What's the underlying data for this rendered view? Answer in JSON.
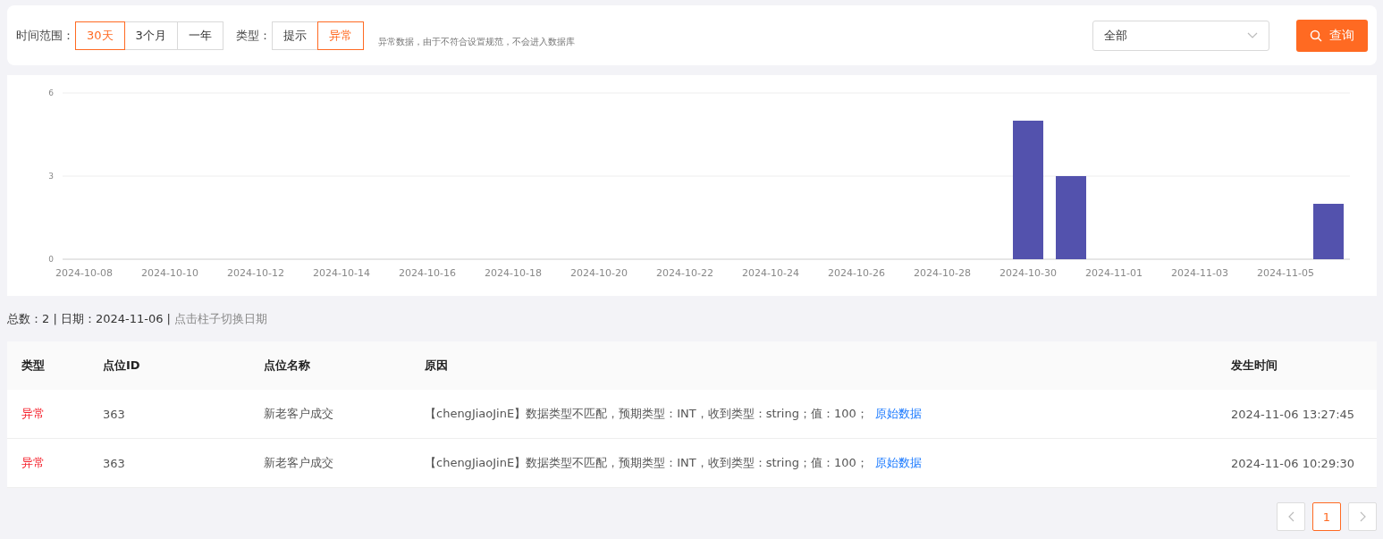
{
  "filters": {
    "range_label": "时间范围：",
    "ranges": [
      {
        "label": "30天",
        "selected": true
      },
      {
        "label": "3个月",
        "selected": false
      },
      {
        "label": "一年",
        "selected": false
      }
    ],
    "type_label": "类型：",
    "types": [
      {
        "label": "提示",
        "selected": false
      },
      {
        "label": "异常",
        "selected": true
      }
    ],
    "note": "异常数据，由于不符合设置规范，不会进入数据库",
    "select": {
      "value": "全部"
    },
    "query_button": "查询"
  },
  "chart": {
    "chart_data": {
      "type": "bar",
      "categories": [
        "2024-10-08",
        null,
        "2024-10-10",
        null,
        "2024-10-12",
        null,
        "2024-10-14",
        null,
        "2024-10-16",
        null,
        "2024-10-18",
        null,
        "2024-10-20",
        null,
        "2024-10-22",
        null,
        "2024-10-24",
        null,
        "2024-10-26",
        null,
        "2024-10-28",
        null,
        "2024-10-30",
        null,
        "2024-11-01",
        null,
        "2024-11-03",
        null,
        "2024-11-05",
        null
      ],
      "values": [
        0,
        0,
        0,
        0,
        0,
        0,
        0,
        0,
        0,
        0,
        0,
        0,
        0,
        0,
        0,
        0,
        0,
        0,
        0,
        0,
        0,
        0,
        5,
        3,
        0,
        0,
        0,
        0,
        0,
        2
      ],
      "ylim": [
        0,
        6
      ],
      "yticks": [
        0,
        3,
        6
      ]
    }
  },
  "summary": {
    "text": "总数：2 | 日期：2024-11-06 |",
    "hint": "点击柱子切换日期"
  },
  "table": {
    "columns": [
      "类型",
      "点位ID",
      "点位名称",
      "原因",
      "发生时间"
    ],
    "rows": [
      {
        "type": "异常",
        "kind": "error",
        "id": "363",
        "name": "新老客户成交",
        "reason": "【chengJiaoJinE】数据类型不匹配，预期类型：INT，收到类型：string；值：100；",
        "link": "原始数据",
        "time": "2024-11-06 13:27:45"
      },
      {
        "type": "异常",
        "kind": "error",
        "id": "363",
        "name": "新老客户成交",
        "reason": "【chengJiaoJinE】数据类型不匹配，预期类型：INT，收到类型：string；值：100；",
        "link": "原始数据",
        "time": "2024-11-06 10:29:30"
      }
    ]
  },
  "pagination": {
    "pages": [
      {
        "label": "1",
        "selected": true
      }
    ]
  }
}
